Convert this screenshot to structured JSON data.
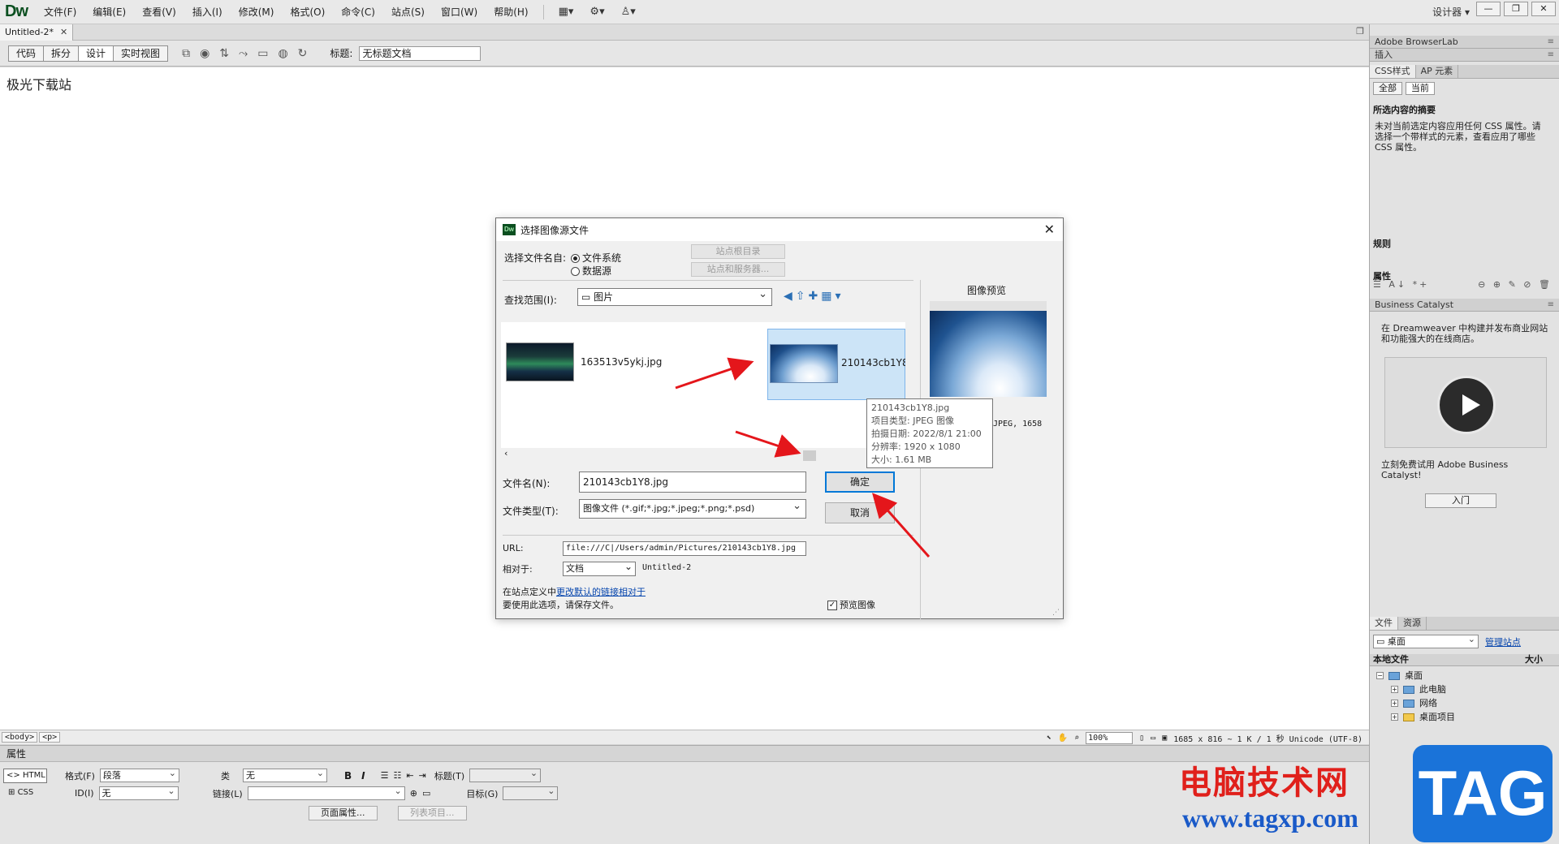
{
  "app": {
    "logo": "Dw",
    "menus": [
      "文件(F)",
      "编辑(E)",
      "查看(V)",
      "插入(I)",
      "修改(M)",
      "格式(O)",
      "命令(C)",
      "站点(S)",
      "窗口(W)",
      "帮助(H)"
    ],
    "designer_label": "设计器"
  },
  "doc": {
    "tab_label": "Untitled-2*",
    "view_buttons": [
      "代码",
      "拆分",
      "设计",
      "实时视图"
    ],
    "title_label": "标题:",
    "title_value": "无标题文档",
    "canvas_text": "极光下载站"
  },
  "status": {
    "tags": [
      "<body>",
      "<p>"
    ],
    "zoom": "100%",
    "info": "1685 x 816 ~ 1 K / 1 秒 Unicode (UTF-8)"
  },
  "props": {
    "title": "属性",
    "html_label": "HTML",
    "css_label": "CSS",
    "format_label": "格式(F)",
    "format_value": "段落",
    "class_label": "类",
    "class_value": "无",
    "id_label": "ID(I)",
    "id_value": "无",
    "link_label": "链接(L)",
    "title_label": "标题(T)",
    "target_label": "目标(G)",
    "bold": "B",
    "italic": "I",
    "page_props_btn": "页面属性...",
    "list_item_btn": "列表项目..."
  },
  "right": {
    "browserlab": "Adobe BrowserLab",
    "insert": "插入",
    "css_tab": "CSS样式",
    "ap_tab": "AP 元素",
    "all_btn": "全部",
    "current_btn": "当前",
    "summary_title": "所选内容的摘要",
    "summary_text": "未对当前选定内容应用任何 CSS 属性。请选择一个带样式的元素，查看应用了哪些 CSS 属性。",
    "rules_title": "规则",
    "props_title": "属性",
    "bc_title": "Business Catalyst",
    "bc_text": "在 Dreamweaver 中构建并发布商业网站和功能强大的在线商店。",
    "bc_try": "立刻免费试用 Adobe Business Catalyst!",
    "bc_enter": "入门",
    "files_tab": "文件",
    "assets_tab": "资源",
    "location": "桌面",
    "manage_sites": "管理站点",
    "local_files": "本地文件",
    "size_col": "大小",
    "tree": [
      "桌面",
      "此电脑",
      "网络",
      "桌面项目"
    ]
  },
  "dialog": {
    "title": "选择图像源文件",
    "select_from": "选择文件名自:",
    "radio_fs": "文件系统",
    "radio_ds": "数据源",
    "site_root_btn": "站点根目录",
    "site_server_btn": "站点和服务器...",
    "look_in_label": "查找范围(I):",
    "look_in_value": "图片",
    "file1": "163513v5ykj.jpg",
    "file2": "210143cb1Y8",
    "tooltip": {
      "name": "210143cb1Y8.jpg",
      "type": "项目类型: JPEG 图像",
      "date": "拍摄日期: 2022/8/1 21:00",
      "res": "分辨率: 1920 x 1080",
      "size": "大小: 1.61 MB"
    },
    "filename_label": "文件名(N):",
    "filename_value": "210143cb1Y8.jpg",
    "filetype_label": "文件类型(T):",
    "filetype_value": "图像文件 (*.gif;*.jpg;*.jpeg;*.png;*.psd)",
    "ok": "确定",
    "cancel": "取消",
    "url_label": "URL:",
    "url_value": "file:///C|/Users/admin/Pictures/210143cb1Y8.jpg",
    "relative_label": "相对于:",
    "relative_value": "文档",
    "relative_doc": "Untitled-2",
    "site_def_prefix": "在站点定义中",
    "site_def_link": "更改默认的链接相对于",
    "save_note": "要使用此选项，请保存文件。",
    "preview_label": "预览图像",
    "preview_title": "图像预览",
    "preview_info": "JPEG, 1658"
  },
  "watermark": {
    "text": "电脑技术网",
    "url": "www.tagxp.com",
    "logo": "TAG"
  }
}
